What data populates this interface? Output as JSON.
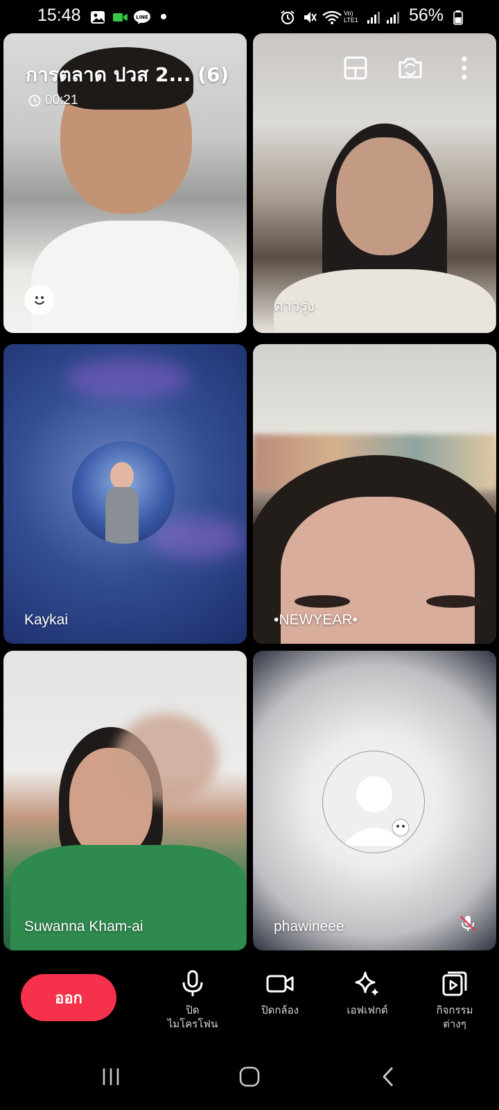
{
  "status_bar": {
    "time": "15:48",
    "battery": "56%",
    "icons": [
      "gallery-icon",
      "video-icon",
      "line-app-icon",
      "dot-icon",
      "alarm-icon",
      "mute-icon",
      "wifi-icon",
      "volte-lte-icon",
      "signal-icon",
      "signal-icon",
      "battery-icon"
    ]
  },
  "call": {
    "title": "การตลาด ปวส 2... (6)",
    "timer": "00:21"
  },
  "participants": [
    {
      "name": ""
    },
    {
      "name": "ดาวรุ่ง"
    },
    {
      "name": "Kaykai"
    },
    {
      "name": "•NEWYEAR•"
    },
    {
      "name": "Suwanna Kham-ai"
    },
    {
      "name": "phawineee",
      "muted": true
    }
  ],
  "controls": {
    "leave_label": "ออก",
    "mic_label_line1": "ปิด",
    "mic_label_line2": "ไมโครโฟน",
    "camera_label": "ปิดกล้อง",
    "effects_label": "เอฟเฟกต์",
    "activities_label_line1": "กิจกรรม",
    "activities_label_line2": "ต่างๆ"
  },
  "colors": {
    "leave_button": "#f5314b",
    "background": "#000000"
  }
}
